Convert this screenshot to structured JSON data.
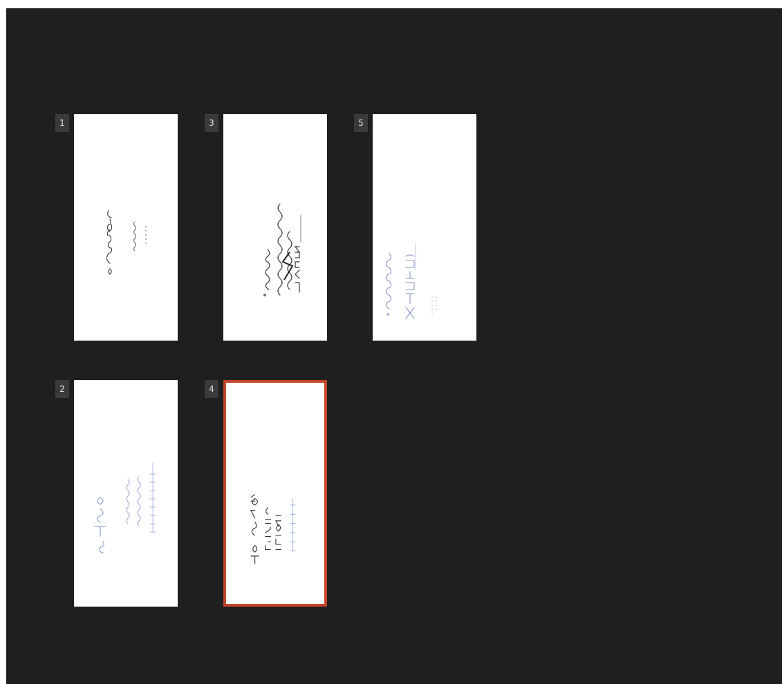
{
  "slides": [
    {
      "number": "1",
      "selected": false
    },
    {
      "number": "2",
      "selected": false
    },
    {
      "number": "3",
      "selected": false
    },
    {
      "number": "4",
      "selected": true
    },
    {
      "number": "5",
      "selected": false
    }
  ],
  "colors": {
    "background": "#1f1f1f",
    "selection_border": "#c4462a",
    "ink_dark": "#333333",
    "ink_blue": "#7a8fd6"
  }
}
